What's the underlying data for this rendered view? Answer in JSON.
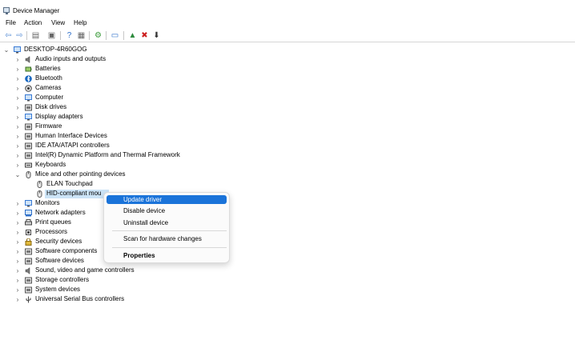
{
  "window": {
    "title": "Device Manager"
  },
  "menu": [
    "File",
    "Action",
    "View",
    "Help"
  ],
  "toolbar": [
    {
      "name": "back-arrow-icon",
      "glyph": "⇦"
    },
    {
      "name": "forward-arrow-icon",
      "glyph": "⇨"
    },
    {
      "name": "show-hide-console-tree-icon",
      "glyph": "▤"
    },
    {
      "name": "properties-icon",
      "glyph": "▣"
    },
    {
      "name": "help-icon",
      "glyph": "?"
    },
    {
      "name": "action-pane-icon",
      "glyph": "▦"
    },
    {
      "name": "scan-hardware-icon",
      "glyph": "⚙"
    },
    {
      "name": "monitor-icon",
      "glyph": "▭"
    },
    {
      "name": "update-driver-icon",
      "glyph": "▲"
    },
    {
      "name": "uninstall-device-icon",
      "glyph": "✖"
    },
    {
      "name": "disable-device-icon",
      "glyph": "⬇"
    }
  ],
  "tree": {
    "root": "DESKTOP-4R60GOG",
    "categories": [
      {
        "label": "Audio inputs and outputs",
        "icon": "speaker-icon",
        "expanded": false
      },
      {
        "label": "Batteries",
        "icon": "battery-icon",
        "expanded": false
      },
      {
        "label": "Bluetooth",
        "icon": "bluetooth-icon",
        "expanded": false
      },
      {
        "label": "Cameras",
        "icon": "camera-icon",
        "expanded": false
      },
      {
        "label": "Computer",
        "icon": "computer-icon",
        "expanded": false
      },
      {
        "label": "Disk drives",
        "icon": "disk-drive-icon",
        "expanded": false
      },
      {
        "label": "Display adapters",
        "icon": "display-adapter-icon",
        "expanded": false
      },
      {
        "label": "Firmware",
        "icon": "firmware-icon",
        "expanded": false
      },
      {
        "label": "Human Interface Devices",
        "icon": "hid-icon",
        "expanded": false
      },
      {
        "label": "IDE ATA/ATAPI controllers",
        "icon": "ide-controller-icon",
        "expanded": false
      },
      {
        "label": "Intel(R) Dynamic Platform and Thermal Framework",
        "icon": "thermal-icon",
        "expanded": false
      },
      {
        "label": "Keyboards",
        "icon": "keyboard-icon",
        "expanded": false
      },
      {
        "label": "Mice and other pointing devices",
        "icon": "mouse-icon",
        "expanded": true,
        "children": [
          {
            "label": "ELAN Touchpad",
            "icon": "mouse-icon",
            "selected": false
          },
          {
            "label": "HID-compliant mou",
            "icon": "mouse-icon",
            "selected": true
          }
        ]
      },
      {
        "label": "Monitors",
        "icon": "monitor-icon",
        "expanded": false
      },
      {
        "label": "Network adapters",
        "icon": "network-adapter-icon",
        "expanded": false
      },
      {
        "label": "Print queues",
        "icon": "printer-icon",
        "expanded": false
      },
      {
        "label": "Processors",
        "icon": "processor-icon",
        "expanded": false
      },
      {
        "label": "Security devices",
        "icon": "security-device-icon",
        "expanded": false
      },
      {
        "label": "Software components",
        "icon": "software-component-icon",
        "expanded": false
      },
      {
        "label": "Software devices",
        "icon": "software-device-icon",
        "expanded": false
      },
      {
        "label": "Sound, video and game controllers",
        "icon": "sound-icon",
        "expanded": false
      },
      {
        "label": "Storage controllers",
        "icon": "storage-controller-icon",
        "expanded": false
      },
      {
        "label": "System devices",
        "icon": "system-device-icon",
        "expanded": false
      },
      {
        "label": "Universal Serial Bus controllers",
        "icon": "usb-icon",
        "expanded": false
      }
    ]
  },
  "context_menu": {
    "items": [
      {
        "label": "Update driver",
        "highlighted": true
      },
      {
        "label": "Disable device"
      },
      {
        "label": "Uninstall device"
      },
      {
        "label": "Scan for hardware changes"
      },
      {
        "label": "Properties",
        "bold": true
      }
    ]
  },
  "colors": {
    "selection": "#cce4f7",
    "menu_highlight": "#1a73d9",
    "bluetooth": "#1565c0",
    "folder_blue": "#3a7bd5"
  }
}
